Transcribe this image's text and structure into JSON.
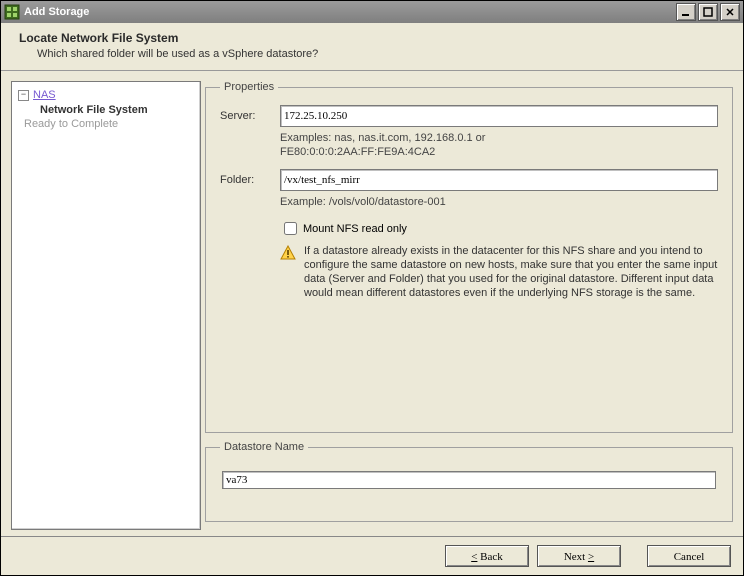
{
  "window": {
    "title": "Add Storage"
  },
  "header": {
    "title": "Locate Network File System",
    "subtitle": "Which shared folder will be used as a vSphere datastore?"
  },
  "sidebar": {
    "root": "NAS",
    "current": "Network File System",
    "ready": "Ready to Complete"
  },
  "properties": {
    "legend": "Properties",
    "serverLabel": "Server:",
    "serverValue": "172.25.10.250",
    "serverExample": "Examples: nas, nas.it.com, 192.168.0.1 or\nFE80:0:0:0:2AA:FF:FE9A:4CA2",
    "folderLabel": "Folder:",
    "folderValue": "/vx/test_nfs_mirr",
    "folderExample": "Example: /vols/vol0/datastore-001",
    "mountReadOnlyLabel": "Mount NFS read only",
    "warning": "If a datastore already exists in the datacenter for this NFS share and you intend to configure the same datastore on new hosts, make sure that you enter the same input data (Server and Folder) that you used for the original datastore. Different input data would mean different datastores even if the underlying NFS storage is the same."
  },
  "datastore": {
    "legend": "Datastore Name",
    "value": "va73"
  },
  "footer": {
    "back": "Back",
    "next": "Next",
    "cancel": "Cancel"
  }
}
